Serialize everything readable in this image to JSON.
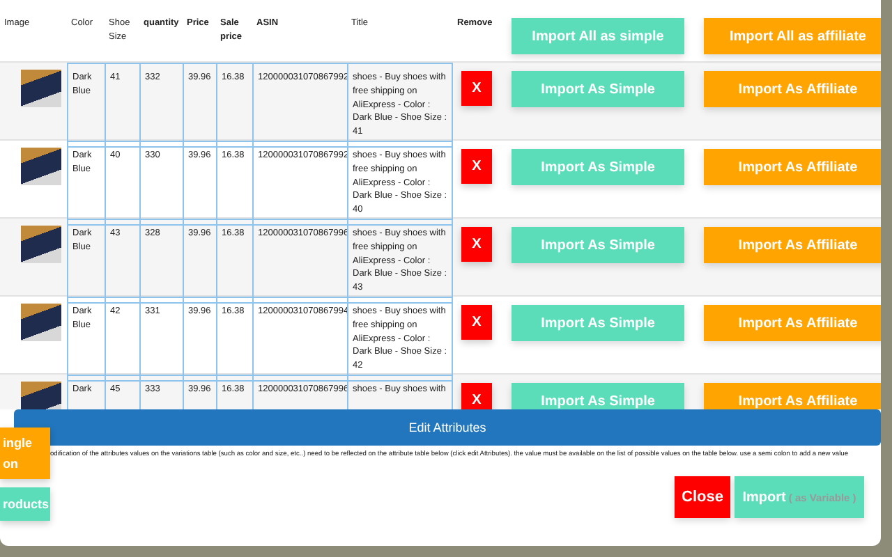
{
  "table": {
    "columns": [
      {
        "label": "Image",
        "bold": false
      },
      {
        "label": "Color",
        "bold": false
      },
      {
        "label": "Shoe Size",
        "bold": false
      },
      {
        "label": "quantity",
        "bold": true
      },
      {
        "label": "Price",
        "bold": true
      },
      {
        "label": "Sale price",
        "bold": true
      },
      {
        "label": "ASIN",
        "bold": true
      },
      {
        "label": "Title",
        "bold": false
      },
      {
        "label": "Remove",
        "bold": true
      }
    ],
    "import_all_simple": "Import All as simple",
    "import_all_affiliate": "Import All as affiliate",
    "rows": [
      {
        "color_name": "Dark Blue",
        "shoe_size": "41",
        "quantity": "332",
        "price": "39.96",
        "sale_price": "16.38",
        "asin": "120000031070867992",
        "title": "shoes - Buy shoes with free shipping on AliExpress - Color : Dark Blue - Shoe Size : 41",
        "remove": "X",
        "import_simple": "Import As Simple",
        "import_affiliate": "Import As Affiliate"
      },
      {
        "color_name": "Dark Blue",
        "shoe_size": "40",
        "quantity": "330",
        "price": "39.96",
        "sale_price": "16.38",
        "asin": "120000031070867992",
        "title": "shoes - Buy shoes with free shipping on AliExpress - Color : Dark Blue - Shoe Size : 40",
        "remove": "X",
        "import_simple": "Import As Simple",
        "import_affiliate": "Import As Affiliate"
      },
      {
        "color_name": "Dark Blue",
        "shoe_size": "43",
        "quantity": "328",
        "price": "39.96",
        "sale_price": "16.38",
        "asin": "120000031070867996",
        "title": "shoes - Buy shoes with free shipping on AliExpress - Color : Dark Blue - Shoe Size : 43",
        "remove": "X",
        "import_simple": "Import As Simple",
        "import_affiliate": "Import As Affiliate"
      },
      {
        "color_name": "Dark Blue",
        "shoe_size": "42",
        "quantity": "331",
        "price": "39.96",
        "sale_price": "16.38",
        "asin": "120000031070867994",
        "title": "shoes - Buy shoes with free shipping on AliExpress - Color : Dark Blue - Shoe Size : 42",
        "remove": "X",
        "import_simple": "Import As Simple",
        "import_affiliate": "Import As Affiliate"
      },
      {
        "color_name": "Dark",
        "shoe_size": "45",
        "quantity": "333",
        "price": "39.96",
        "sale_price": "16.38",
        "asin": "120000031070867996",
        "title": "shoes - Buy shoes with",
        "remove": "X",
        "import_simple": "Import As Simple",
        "import_affiliate": "Import As Affiliate"
      }
    ]
  },
  "edit_attributes": "Edit Attributes",
  "note": "odification of the attributes values on the variations table (such as color and size, etc..) need to be reflected on the attribute table below (click edit Attributes). the value must be available on the list of possible values on the table below. use a semi colon to add a new value",
  "close_button": "Close",
  "import_button": {
    "label": "Import",
    "suffix": "( as Variable )"
  },
  "background_buttons": [
    {
      "label": "ingle on",
      "kind": "orange"
    },
    {
      "label": "roducts",
      "kind": "teal"
    }
  ]
}
